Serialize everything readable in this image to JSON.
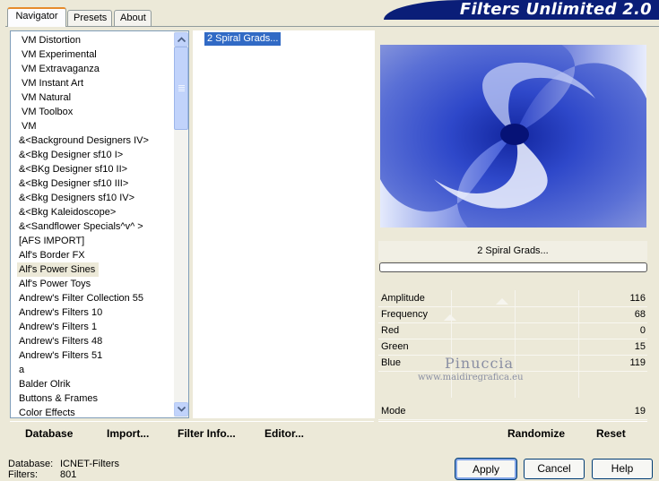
{
  "tabs": [
    {
      "label": "Navigator",
      "active": true
    },
    {
      "label": "Presets",
      "active": false
    },
    {
      "label": "About",
      "active": false
    }
  ],
  "banner": {
    "title": "Filters Unlimited 2.0"
  },
  "categories": {
    "items": [
      {
        "label": "VM Distortion"
      },
      {
        "label": "VM Experimental"
      },
      {
        "label": "VM Extravaganza"
      },
      {
        "label": "VM Instant Art"
      },
      {
        "label": "VM Natural"
      },
      {
        "label": "VM Toolbox"
      },
      {
        "label": "VM"
      },
      {
        "label": "&<Background Designers IV>"
      },
      {
        "label": "&<Bkg Designer sf10 I>"
      },
      {
        "label": "&<BKg Designer sf10 II>"
      },
      {
        "label": "&<Bkg Designer sf10 III>"
      },
      {
        "label": "&<Bkg Designers sf10 IV>"
      },
      {
        "label": "&<Bkg Kaleidoscope>"
      },
      {
        "label": "&<Sandflower Specials^v^ >"
      },
      {
        "label": "[AFS IMPORT]"
      },
      {
        "label": "Alf's Border FX"
      },
      {
        "label": "Alf's Power Sines",
        "selected": true
      },
      {
        "label": "Alf's Power Toys"
      },
      {
        "label": "Andrew's Filter Collection 55"
      },
      {
        "label": "Andrew's Filters 10"
      },
      {
        "label": "Andrew's Filters 1"
      },
      {
        "label": "Andrew's Filters 48"
      },
      {
        "label": "Andrew's Filters 51"
      },
      {
        "label": "a"
      },
      {
        "label": "Balder Olrik"
      },
      {
        "label": "Buttons & Frames"
      },
      {
        "label": "Color Effects"
      }
    ]
  },
  "filters": {
    "items": [
      {
        "label": "2 Spiral Grads...",
        "selected": true
      }
    ]
  },
  "preview": {
    "filter_name": "2 Spiral Grads..."
  },
  "params": [
    {
      "label": "Amplitude",
      "value": "116"
    },
    {
      "label": "Frequency",
      "value": "68"
    },
    {
      "label": "Red",
      "value": "0"
    },
    {
      "label": "Green",
      "value": "15"
    },
    {
      "label": "Blue",
      "value": "119"
    },
    {
      "label": "Mode",
      "value": "19"
    }
  ],
  "watermark": {
    "name": "Pinuccia",
    "site": "www.maidiregrafica.eu"
  },
  "bottom_buttons": {
    "database": "Database",
    "import": "Import...",
    "filter_info": "Filter Info...",
    "editor": "Editor...",
    "randomize": "Randomize",
    "reset": "Reset"
  },
  "status": {
    "database_label": "Database:",
    "database_value": "ICNET-Filters",
    "filters_label": "Filters:",
    "filters_value": "801"
  },
  "dialog_buttons": {
    "apply": "Apply",
    "cancel": "Cancel",
    "help": "Help"
  },
  "colors": {
    "banner": "#0a1e78",
    "selection": "#316ac5",
    "accent_tab": "#e68b2c"
  },
  "icons": {
    "scroll_up": "chevron-up-icon",
    "scroll_down": "chevron-down-icon"
  }
}
